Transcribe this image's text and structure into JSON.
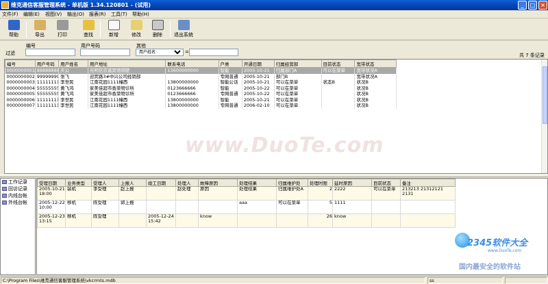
{
  "window": {
    "title": "维克通信客服管理系统 - 单机版 1.34.120801 - (试用)"
  },
  "menu": [
    "文件(F)",
    "编辑(E)",
    "视图(V)",
    "输出(O)",
    "报表(R)",
    "工具(T)",
    "帮助(H)"
  ],
  "toolbar": [
    "帮助",
    "导出",
    "打印",
    "查找",
    "新增",
    "修改",
    "删除",
    "退出系统"
  ],
  "filter": {
    "label": "过滤",
    "field1_label": "编号",
    "field2_label": "用户号码",
    "field3_label": "其他",
    "select_value": "用户姓名",
    "eq": "=",
    "count": "共 7 条记录"
  },
  "grid1": {
    "headers": [
      "编号",
      "用户号码",
      "用户姓名",
      "用户地址",
      "联系电话",
      "户类",
      "开通日期",
      "归属经营部",
      "目前状态",
      "宽带状态"
    ],
    "rows": [
      [
        "0000000001",
        "88888888",
        "天公",
        "光明信京道宾馆隔壁",
        "13600000000",
        "智能",
        "2005-10-21",
        "归属部门A",
        "可以在菜单",
        "宽带状况A"
      ],
      [
        "0000000002",
        "99999999",
        "张飞",
        "迎宾路3#中兴公司经销部",
        "",
        "专网普通",
        "2005-10-21",
        "部门B",
        "",
        "宽带状况A"
      ],
      [
        "0000000003",
        "11111111",
        "李世民",
        "江南花园1111幢西",
        "13800000000",
        "智能公话",
        "2005-10-21",
        "可以在菜单",
        "状态B",
        "状况B"
      ],
      [
        "0000000004",
        "55555555",
        "黄飞鸿",
        "家美佳超市香菜物诊所",
        "0123666666",
        "智能",
        "2005-10-22",
        "可以在菜单",
        "",
        "状况B"
      ],
      [
        "0000000005",
        "55555555",
        "黄飞鸿",
        "家美佳超市香菜物诊所",
        "0123666666",
        "专网普通",
        "2005-10-22",
        "可以在菜单",
        "",
        "状况B"
      ],
      [
        "0000000006",
        "11111111",
        "李世民",
        "江南花园1111幢西",
        "13800000000",
        "智能",
        "2005-10-21",
        "可以在菜单",
        "",
        "状况B"
      ],
      [
        "0000000007",
        "11111111",
        "李世民",
        "江南花园1111幢西",
        "13800000000",
        "专网普通",
        "2006-02-10",
        "可以在菜单",
        "",
        "状况B"
      ]
    ]
  },
  "sidebar": [
    "工作记录",
    "回访记录",
    "内线台帐",
    "外线台帐"
  ],
  "grid2": {
    "headers": [
      "受理日期",
      "业务类型",
      "受理人",
      "上报人",
      "竣工日期",
      "处理人",
      "故障原因",
      "处理结果",
      "归属维护处",
      "处理时限",
      "延时原因",
      "目前状态",
      "备注"
    ],
    "rows": [
      [
        "2005-10-21 18:00",
        "装机",
        "李受理",
        "赵上报",
        "",
        "赵处理",
        "原因",
        "处理结果",
        "归属维护处A",
        "2",
        "2222",
        "可以在菜单",
        "213213 21312121 2131"
      ],
      [
        "2005-12-22 10:00",
        "移机",
        "陈受理",
        "郭上报",
        "",
        "",
        "",
        "aaa",
        "可以在菜单",
        "5",
        "1111",
        "",
        ""
      ],
      [
        "2005-12-23 13:15",
        "移机",
        "陈受理",
        "",
        "2005-12-24 15:42",
        "",
        "know",
        "",
        "",
        "26",
        "know",
        "",
        ""
      ]
    ]
  },
  "watermark": "www.DuoTe.com",
  "logo": {
    "brand": "2345软件大全",
    "url": "www.DuoTe.com",
    "slogan": "国内最安全的软件站"
  },
  "status": {
    "path": "C:\\Program Files\\维克通信客服管理系统\\vkcrmts.mdb",
    "c2": "ss"
  }
}
